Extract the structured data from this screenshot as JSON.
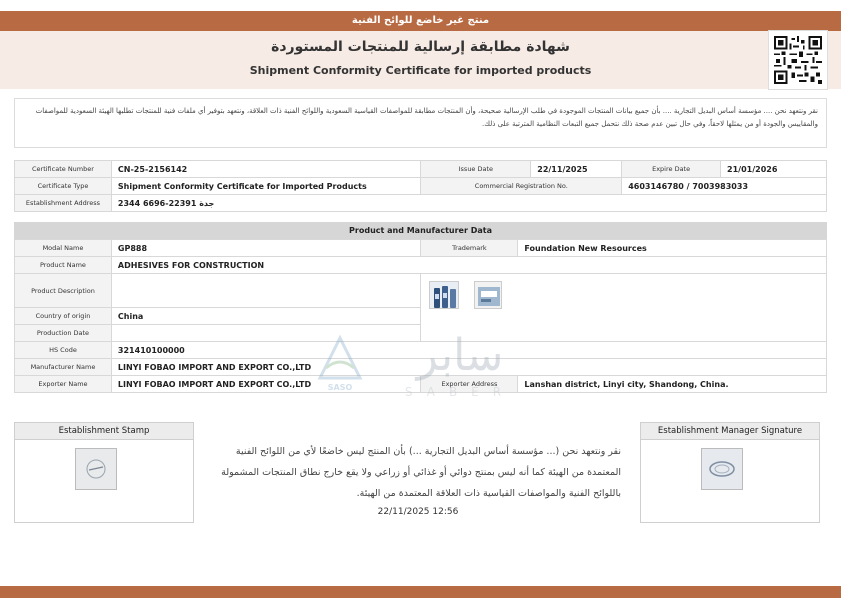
{
  "topbar": {
    "text": "منتج غير خاضع للوائح الفنية"
  },
  "header": {
    "title_ar": "شهادة مطابقة إرسالية للمنتجات المستوردة",
    "title_en": "Shipment Conformity Certificate for imported products"
  },
  "pledge": {
    "text": "نقر ونتعهد نحن .... مؤسسة أساس البديل التجارية .... بأن جميع بيانات المنتجات الموجودة في طلب الإرسالية صحيحة، وأن المنتجات مطابقة للمواصفات القياسية السعودية واللوائح الفنية ذات العلاقة، ونتعهد بتوفير أي ملفات فنية للمنتجات تطلبها الهيئة السعودية للمواصفات والمقاييس والجودة أو من يمثلها لاحقاً، وفي حال تبين عدم صحة ذلك نتحمل جميع التبعات النظامية المترتبة على ذلك."
  },
  "certificate": {
    "number_label": "Certificate Number",
    "number": "CN-25-2156142",
    "issue_label": "Issue Date",
    "issue": "22/11/2025",
    "expire_label": "Expire Date",
    "expire": "21/01/2026",
    "type_label": "Certificate Type",
    "type": "Shipment Conformity Certificate for Imported Products",
    "cr_label": "Commercial Registration No.",
    "cr": "4603146780 / 7003983033",
    "address_label": "Establishment Address",
    "address": "جدة 22391-6696 2344"
  },
  "product": {
    "section_title": "Product and Manufacturer Data",
    "model_label": "Modal Name",
    "model": "GP888",
    "trademark_label": "Trademark",
    "trademark": "Foundation New Resources",
    "name_label": "Product Name",
    "name": "ADHESIVES FOR CONSTRUCTION",
    "desc_label": "Product Description",
    "desc": "",
    "origin_label": "Country of origin",
    "origin": "China",
    "prod_date_label": "Production Date",
    "prod_date": "",
    "hs_label": "HS Code",
    "hs": "321410100000",
    "manufacturer_label": "Manufacturer Name",
    "manufacturer": "LINYI FOBAO IMPORT AND EXPORT CO.,LTD",
    "exporter_label": "Exporter Name",
    "exporter": "LINYI FOBAO IMPORT AND EXPORT CO.,LTD",
    "exporter_addr_label": "Exporter Address",
    "exporter_addr": "Lanshan district, Linyi city, Shandong, China."
  },
  "watermark": {
    "text_ar": "سابر",
    "text_en": "SABER",
    "logo_text": "SASO"
  },
  "stamps": {
    "left_title": "Establishment Stamp",
    "right_title": "Establishment Manager Signature"
  },
  "statement": {
    "text": "نقر ونتعهد نحن (... مؤسسة أساس البديل التجارية ...) بأن المنتج ليس خاضعًا لأي من اللوائح الفنية المعتمدة من الهيئة كما أنه ليس بمنتج دوائي أو غذائي أو زراعي ولا يقع خارج نطاق المنتجات المشمولة باللوائح الفنية والمواصفات القياسية ذات العلاقة المعتمدة من الهيئة.",
    "datetime": "22/11/2025 12:56"
  },
  "colors": {
    "brand": "#b86a42",
    "header_bg": "#f7ebe6",
    "label_bg": "#f3f3f3",
    "section_bg": "#d6d6d6"
  }
}
